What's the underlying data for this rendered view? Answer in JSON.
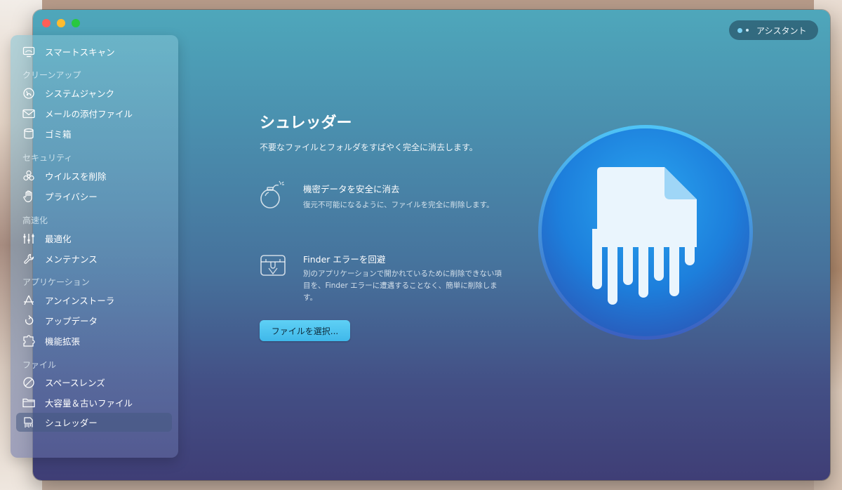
{
  "window": {
    "assistant_label": "アシスタント"
  },
  "sidebar": {
    "items": [
      {
        "label": "スマートスキャン",
        "icon": "monitor-scan-icon"
      },
      {
        "label": "システムジャンク",
        "icon": "system-junk-icon"
      },
      {
        "label": "メールの添付ファイル",
        "icon": "mail-icon"
      },
      {
        "label": "ゴミ箱",
        "icon": "trash-icon"
      },
      {
        "label": "ウイルスを削除",
        "icon": "biohazard-icon"
      },
      {
        "label": "プライバシー",
        "icon": "hand-icon"
      },
      {
        "label": "最適化",
        "icon": "sliders-icon"
      },
      {
        "label": "メンテナンス",
        "icon": "wrench-icon"
      },
      {
        "label": "アンインストーラ",
        "icon": "app-store-icon"
      },
      {
        "label": "アップデータ",
        "icon": "update-arrow-icon"
      },
      {
        "label": "機能拡張",
        "icon": "puzzle-icon"
      },
      {
        "label": "スペースレンズ",
        "icon": "lens-icon"
      },
      {
        "label": "大容量＆古いファイル",
        "icon": "folder-icon"
      },
      {
        "label": "シュレッダー",
        "icon": "shredder-icon"
      }
    ],
    "sections": [
      "クリーンアップ",
      "セキュリティ",
      "高速化",
      "アプリケーション",
      "ファイル"
    ],
    "active_item": "シュレッダー"
  },
  "main": {
    "title": "シュレッダー",
    "subtitle": "不要なファイルとフォルダをすばやく完全に消去します。",
    "features": [
      {
        "title": "機密データを安全に消去",
        "desc": "復元不可能になるように、ファイルを完全に削除します。",
        "icon": "bomb-icon"
      },
      {
        "title": "Finder エラーを回避",
        "desc": "別のアプリケーションで開かれているために削除できない項目を、Finder エラーに遭遇することなく、簡単に削除します。",
        "icon": "locked-box-icon"
      }
    ],
    "select_button": "ファイルを選択...",
    "hero_icon": "shredded-document-icon"
  },
  "colors": {
    "accent": "#4fc3f0",
    "hero_blue": "#1f86e0"
  }
}
